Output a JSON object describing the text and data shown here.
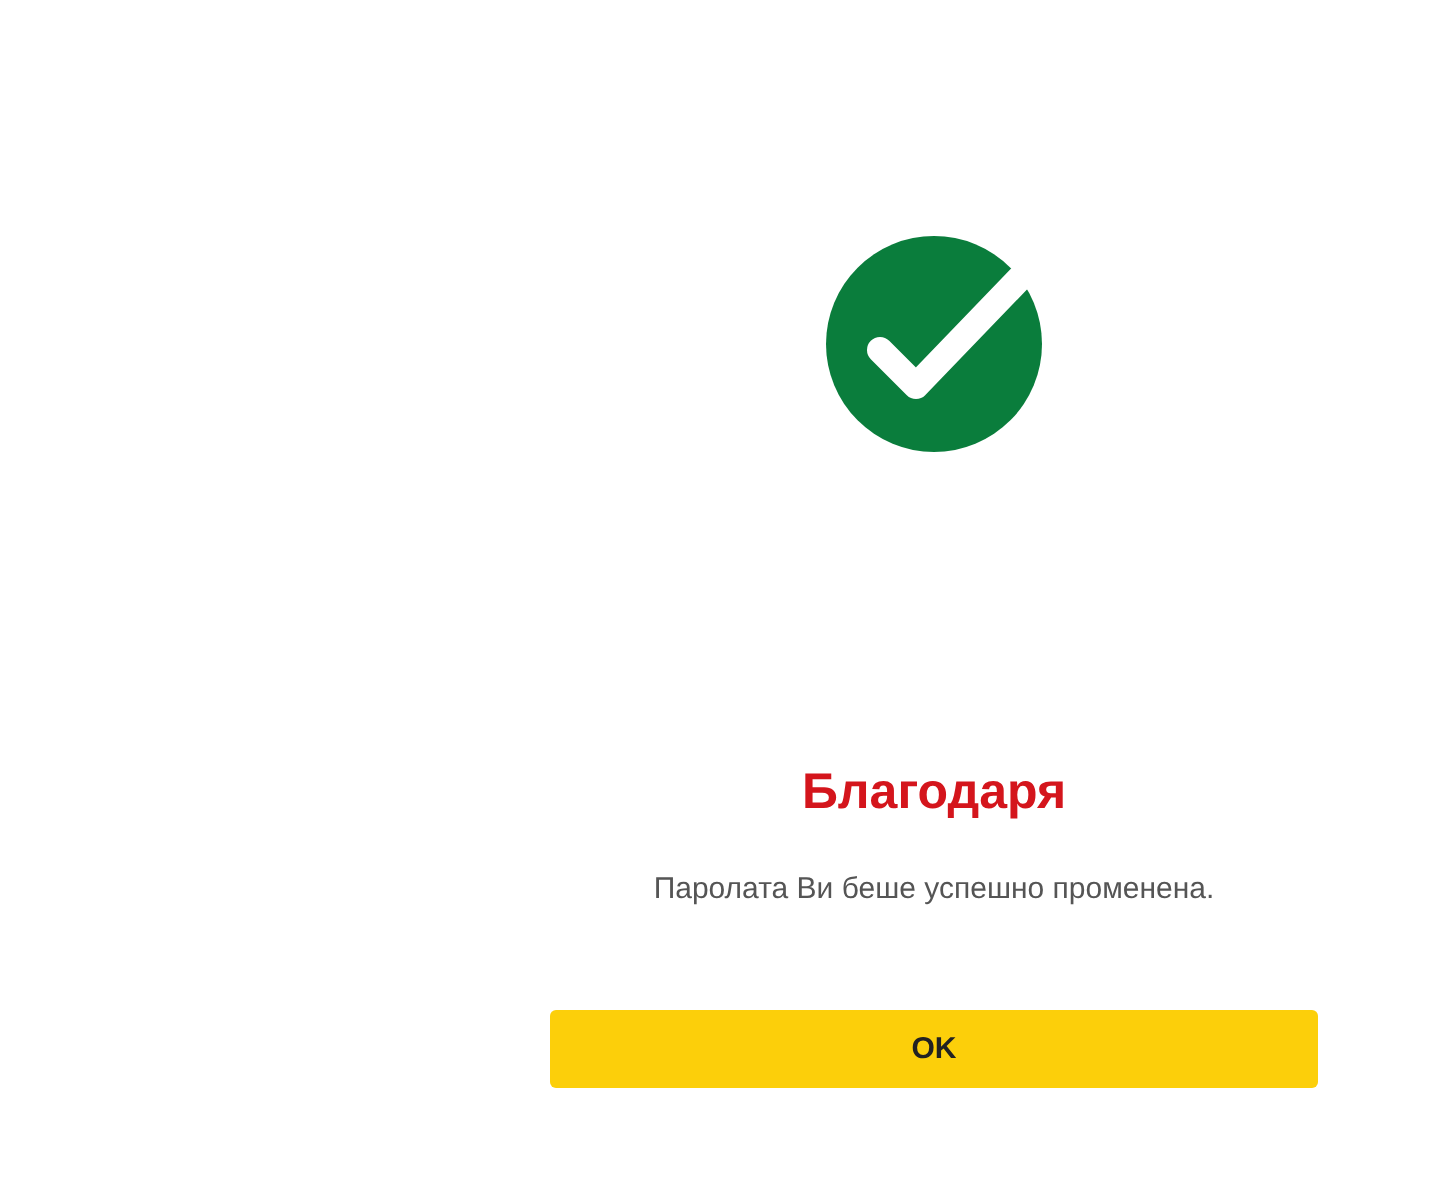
{
  "title": "Благодаря",
  "message": "Паролата Ви беше успешно променена.",
  "button": {
    "label": "OK"
  }
}
